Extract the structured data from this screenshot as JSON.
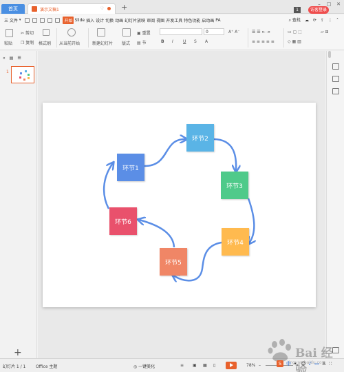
{
  "titlebar": {
    "home_tab": "首页",
    "doc_tab": "演示文稿1",
    "badge": "1",
    "login_label": "访客登录"
  },
  "menubar": {
    "file_label": "三 文件",
    "items": [
      "开始",
      "Slide",
      "插入",
      "设计",
      "切换",
      "动画",
      "幻灯片放映",
      "审阅",
      "视图",
      "开发工具",
      "特色功能",
      "启动画",
      "PA"
    ],
    "search_label": "查找"
  },
  "ribbon": {
    "paste": "粘贴",
    "cut": "剪切",
    "copy": "复制",
    "format_painter": "格式刷",
    "from_current": "从当前开始",
    "new_slide": "新建幻灯片",
    "layout": "版式",
    "reset": "重置",
    "section": "节",
    "font_size": "0",
    "bold": "B",
    "italic": "I",
    "underline": "U",
    "strike": "S",
    "font_color": "A"
  },
  "slides_panel": {
    "slide_number": "1"
  },
  "diagram": {
    "nodes": [
      {
        "label": "环节1",
        "color": "#5b8ee6"
      },
      {
        "label": "环节2",
        "color": "#5ab4e6"
      },
      {
        "label": "环节3",
        "color": "#4fca8a"
      },
      {
        "label": "环节4",
        "color": "#ffba4f"
      },
      {
        "label": "环节5",
        "color": "#f08666"
      },
      {
        "label": "环节6",
        "color": "#e9516c"
      }
    ],
    "arrow_color": "#5b8ee6"
  },
  "statusbar": {
    "slide_count": "幻灯片 1 / 1",
    "theme": "Office 主题",
    "beautify": "一键美化",
    "zoom": "78%"
  },
  "watermark": {
    "text": "Bai 经验",
    "url": "jingyan.baidu.com"
  },
  "tray": {
    "ime": "中"
  }
}
